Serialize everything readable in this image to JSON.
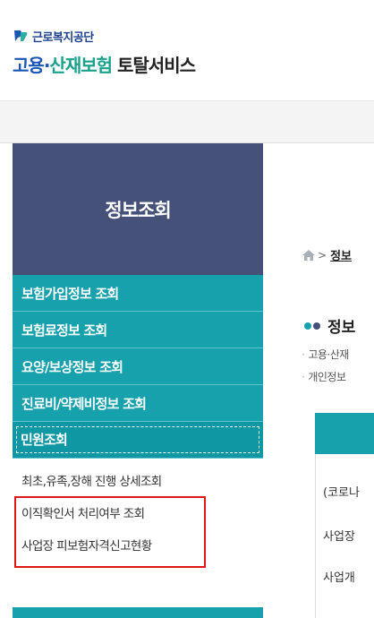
{
  "header": {
    "org_name": "근로복지공단",
    "title_part1": "고용",
    "title_dot": "·",
    "title_part2": "산재보험",
    "title_part3": "토탈서비스"
  },
  "sidebar": {
    "heading": "정보조회",
    "menu": [
      {
        "label": "보험가입정보 조회"
      },
      {
        "label": "보험료정보 조회"
      },
      {
        "label": "요양/보상정보 조회"
      },
      {
        "label": "진료비/약제비정보 조회"
      },
      {
        "label": "민원조회"
      }
    ],
    "sub_items": [
      {
        "label": "최초,유족,장해 진행 상세조회"
      },
      {
        "label": "이직확인서 처리여부 조회"
      },
      {
        "label": "사업장 피보험자격신고현황"
      }
    ]
  },
  "content": {
    "breadcrumb_current": "정보",
    "section_title": "정보",
    "bullets": [
      "고용·산재",
      "개인정보"
    ],
    "rows": [
      "(코로나",
      "사업장",
      "사업개"
    ]
  },
  "colors": {
    "brand_blue": "#1a56b8",
    "brand_green": "#1aa18b",
    "sidebar_header": "#455178",
    "menu_teal": "#16a1ad",
    "highlight_red": "#e1161b"
  }
}
